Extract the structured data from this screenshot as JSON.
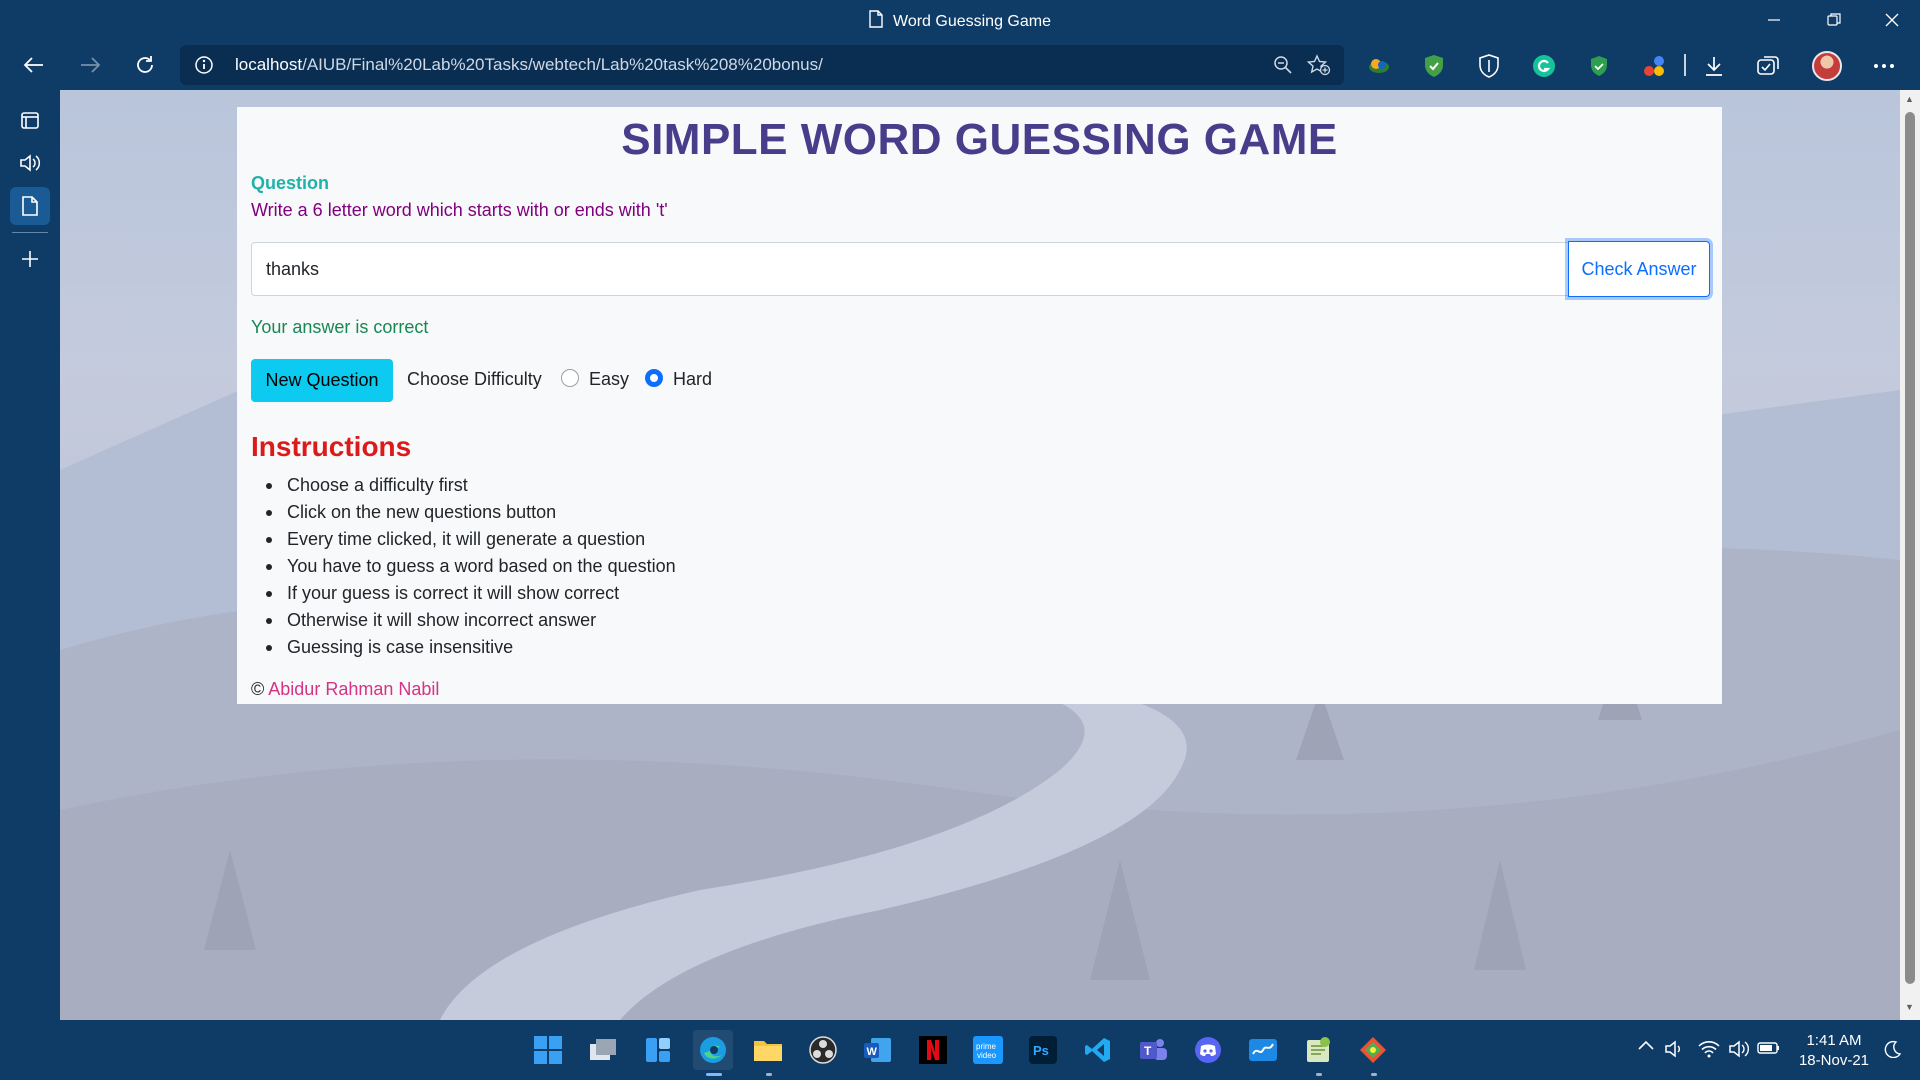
{
  "browser": {
    "window_title": "Word Guessing Game",
    "url_host": "localhost",
    "url_path": "/AIUB/Final%20Lab%20Tasks/webtech/Lab%20task%208%20bonus/"
  },
  "page": {
    "heading": "SIMPLE WORD GUESSING GAME",
    "question_label": "Question",
    "question_text": "Write a 6 letter word which starts with or ends with 't'",
    "answer_value": "thanks",
    "check_button": "Check Answer",
    "result_text": "Your answer is correct",
    "new_question_button": "New Question",
    "difficulty_label": "Choose Difficulty",
    "difficulty_options": [
      "Easy",
      "Hard"
    ],
    "difficulty_selected": "Hard",
    "instructions_title": "Instructions",
    "instructions": [
      "Choose a difficulty first",
      "Click on the new questions button",
      "Every time clicked, it will generate a question",
      "You have to guess a word based on the question",
      "If your guess is correct it will show correct",
      "Otherwise it will show incorrect answer",
      "Guessing is case insensitive"
    ],
    "footer_symbol": "©",
    "footer_author": "Abidur Rahman Nabil"
  },
  "taskbar": {
    "clock_time": "1:41 AM",
    "clock_date": "18-Nov-21"
  },
  "colors": {
    "heading": "#483d8b",
    "question_label": "#20b2aa",
    "question_text": "#800080",
    "result": "#198754",
    "instructions_title": "#dc1a1a",
    "author_link": "#d63384",
    "browser_chrome": "#0f3c66"
  }
}
